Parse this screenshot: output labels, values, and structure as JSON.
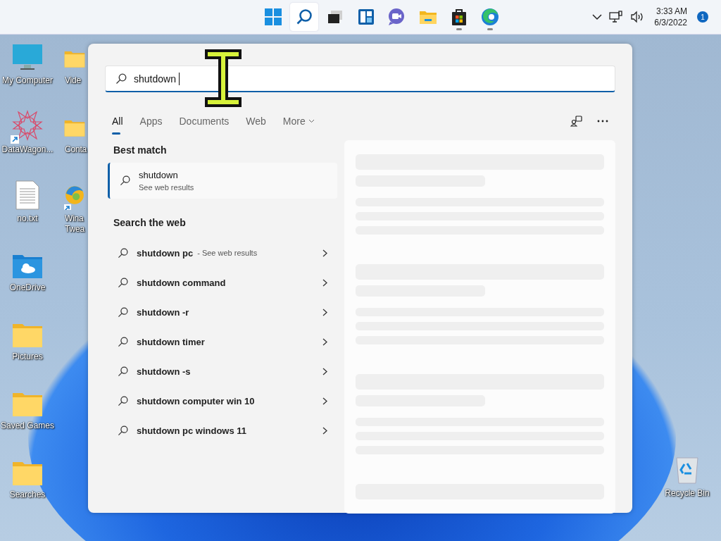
{
  "taskbar": {
    "apps": [
      {
        "kind": "start",
        "selected": false,
        "running": false
      },
      {
        "kind": "search",
        "selected": true,
        "running": false
      },
      {
        "kind": "taskview",
        "selected": false,
        "running": false
      },
      {
        "kind": "widgets",
        "selected": false,
        "running": false
      },
      {
        "kind": "chat",
        "selected": false,
        "running": false
      },
      {
        "kind": "explorer",
        "selected": false,
        "running": false
      },
      {
        "kind": "store",
        "selected": false,
        "running": true
      },
      {
        "kind": "browser",
        "selected": false,
        "running": true
      }
    ],
    "tray": {
      "time": "3:33 AM",
      "date": "6/3/2022",
      "notifications": "1"
    }
  },
  "desktop": {
    "columns": [
      [
        {
          "kind": "monitor",
          "label": "My Computer",
          "shortcut": false
        },
        {
          "kind": "star",
          "label": "DataWagon...",
          "shortcut": true
        },
        {
          "kind": "textfile",
          "label": "no.txt",
          "shortcut": false
        },
        {
          "kind": "cloudfolder",
          "label": "OneDrive",
          "shortcut": false
        },
        {
          "kind": "folder",
          "label": "Pictures",
          "shortcut": false
        },
        {
          "kind": "folder",
          "label": "Saved Games",
          "shortcut": false
        },
        {
          "kind": "folder",
          "label": "Searches",
          "shortcut": false
        }
      ],
      [
        {
          "kind": "folder",
          "label": "Vide",
          "shortcut": false
        },
        {
          "kind": "folder",
          "label": "Conta",
          "shortcut": false
        },
        {
          "kind": "swirl",
          "label": "Wina Twea",
          "shortcut": true
        }
      ]
    ],
    "recycle_bin": {
      "label": "Recycle Bin"
    }
  },
  "search": {
    "query": "shutdown",
    "tabs": [
      {
        "label": "All",
        "selected": true,
        "menu": false
      },
      {
        "label": "Apps",
        "selected": false,
        "menu": false
      },
      {
        "label": "Documents",
        "selected": false,
        "menu": false
      },
      {
        "label": "Web",
        "selected": false,
        "menu": false
      },
      {
        "label": "More",
        "selected": false,
        "menu": true
      }
    ],
    "best_match_heading": "Best match",
    "best_match": {
      "title": "shutdown",
      "subtitle": "See web results",
      "selected": true
    },
    "web_heading": "Search the web",
    "web_results": [
      {
        "text": "shutdown pc",
        "suffix": "- See web results"
      },
      {
        "text": "shutdown command"
      },
      {
        "text": "shutdown -r"
      },
      {
        "text": "shutdown timer"
      },
      {
        "text": "shutdown -s"
      },
      {
        "text": "shutdown computer win 10"
      },
      {
        "text": "shutdown pc windows 11"
      }
    ]
  }
}
